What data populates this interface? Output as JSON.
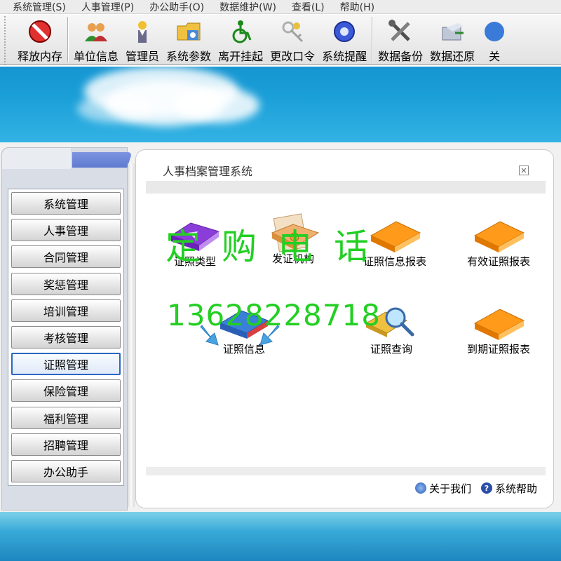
{
  "menu": [
    "系统管理(S)",
    "人事管理(P)",
    "办公助手(O)",
    "数据维护(W)",
    "查看(L)",
    "帮助(H)"
  ],
  "toolbar": [
    {
      "label": "释放内存",
      "icon": "no-entry-icon"
    },
    {
      "label": "单位信息",
      "icon": "users-icon"
    },
    {
      "label": "管理员",
      "icon": "admin-icon"
    },
    {
      "label": "系统参数",
      "icon": "folder-settings-icon"
    },
    {
      "label": "离开挂起",
      "icon": "wheelchair-icon"
    },
    {
      "label": "更改口令",
      "icon": "keys-icon"
    },
    {
      "label": "系统提醒",
      "icon": "gear-icon"
    },
    {
      "label": "数据备份",
      "icon": "tools-icon"
    },
    {
      "label": "数据还原",
      "icon": "restore-icon"
    },
    {
      "label": "关",
      "icon": "exit-icon"
    }
  ],
  "sidebar": [
    "系统管理",
    "人事管理",
    "合同管理",
    "奖惩管理",
    "培训管理",
    "考核管理",
    "证照管理",
    "保险管理",
    "福利管理",
    "招聘管理",
    "办公助手"
  ],
  "sidebar_active": "证照管理",
  "content": {
    "title": "人事档案管理系统",
    "close_glyph": "✕",
    "modules": [
      {
        "label": "证照类型",
        "icon": "purple-book-icon"
      },
      {
        "label": "发证机构",
        "icon": "document-folder-icon"
      },
      {
        "label": "证照信息报表",
        "icon": "orange-folder-icon"
      },
      {
        "label": "有效证照报表",
        "icon": "orange-folder-icon"
      },
      {
        "label": "证照信息",
        "icon": "blue-book-icon"
      },
      {
        "label": "证照查询",
        "icon": "search-book-icon"
      },
      {
        "label": "到期证照报表",
        "icon": "orange-folder-icon"
      }
    ],
    "footer": {
      "about": "关于我们",
      "help": "系统帮助",
      "help_glyph": "?"
    }
  },
  "watermark": {
    "line1": "定购电话",
    "line2": "13628228718"
  },
  "colors": {
    "accent": "#2a66c2",
    "watermark": "#22cf22",
    "sky": "#1b9fd8"
  }
}
